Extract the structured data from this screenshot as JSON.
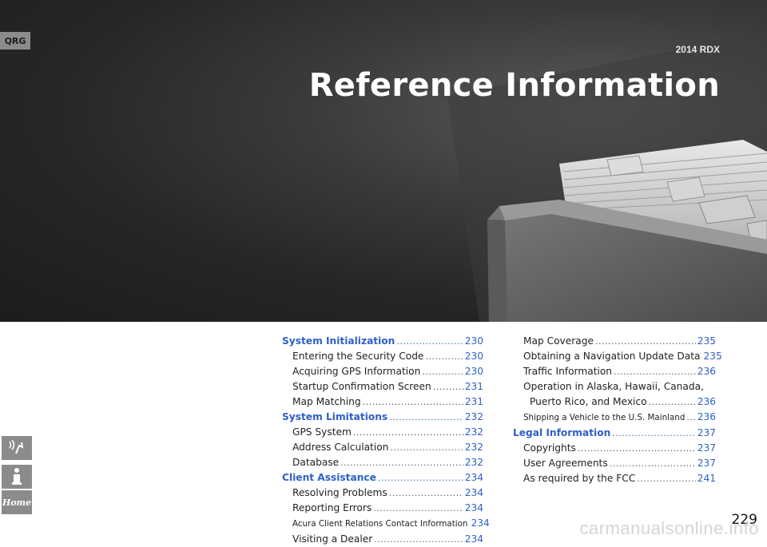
{
  "header": {
    "qrg_label": "QRG",
    "model": "2014 RDX",
    "title": "Reference Information"
  },
  "toc_left": [
    {
      "label": "System Initialization",
      "page": "230",
      "kind": "sec"
    },
    {
      "label": "Entering the Security Code",
      "page": "230",
      "kind": "sub"
    },
    {
      "label": "Acquiring GPS Information",
      "page": "230",
      "kind": "sub"
    },
    {
      "label": "Startup Confirmation Screen",
      "page": "231",
      "kind": "sub"
    },
    {
      "label": "Map Matching",
      "page": "231",
      "kind": "sub"
    },
    {
      "label": "System Limitations",
      "page": "232",
      "kind": "sec"
    },
    {
      "label": "GPS System",
      "page": "232",
      "kind": "sub"
    },
    {
      "label": "Address Calculation",
      "page": "232",
      "kind": "sub"
    },
    {
      "label": "Database",
      "page": "232",
      "kind": "sub"
    },
    {
      "label": "Client Assistance",
      "page": "234",
      "kind": "sec"
    },
    {
      "label": "Resolving Problems",
      "page": "234",
      "kind": "sub"
    },
    {
      "label": "Reporting Errors",
      "page": "234",
      "kind": "sub"
    },
    {
      "label": "Acura Client Relations Contact Information",
      "page": "234",
      "kind": "sub small"
    },
    {
      "label": "Visiting a Dealer",
      "page": "234",
      "kind": "sub"
    }
  ],
  "toc_right": [
    {
      "label": "Map Coverage",
      "page": "235",
      "kind": "sub"
    },
    {
      "label": "Obtaining a Navigation Update Data",
      "page": "235",
      "kind": "sub"
    },
    {
      "label": "Traffic Information",
      "page": "236",
      "kind": "sub"
    },
    {
      "label": "Operation in Alaska, Hawaii, Canada,",
      "page": "",
      "kind": "plain"
    },
    {
      "label": "Puerto Rico, and Mexico",
      "page": "236",
      "kind": "sub2"
    },
    {
      "label": "Shipping a Vehicle to the U.S. Mainland",
      "page": "236",
      "kind": "sub small"
    },
    {
      "label": "Legal Information",
      "page": "237",
      "kind": "sec"
    },
    {
      "label": "Copyrights",
      "page": "237",
      "kind": "sub"
    },
    {
      "label": "User Agreements",
      "page": "237",
      "kind": "sub"
    },
    {
      "label": "As required by the FCC",
      "page": "241",
      "kind": "sub"
    }
  ],
  "side_nav": [
    {
      "name": "voice-command-icon"
    },
    {
      "name": "info-icon"
    },
    {
      "name": "home-icon",
      "label": "Home"
    }
  ],
  "footer": {
    "page_number": "229",
    "watermark": "carmanualsonline.info"
  }
}
